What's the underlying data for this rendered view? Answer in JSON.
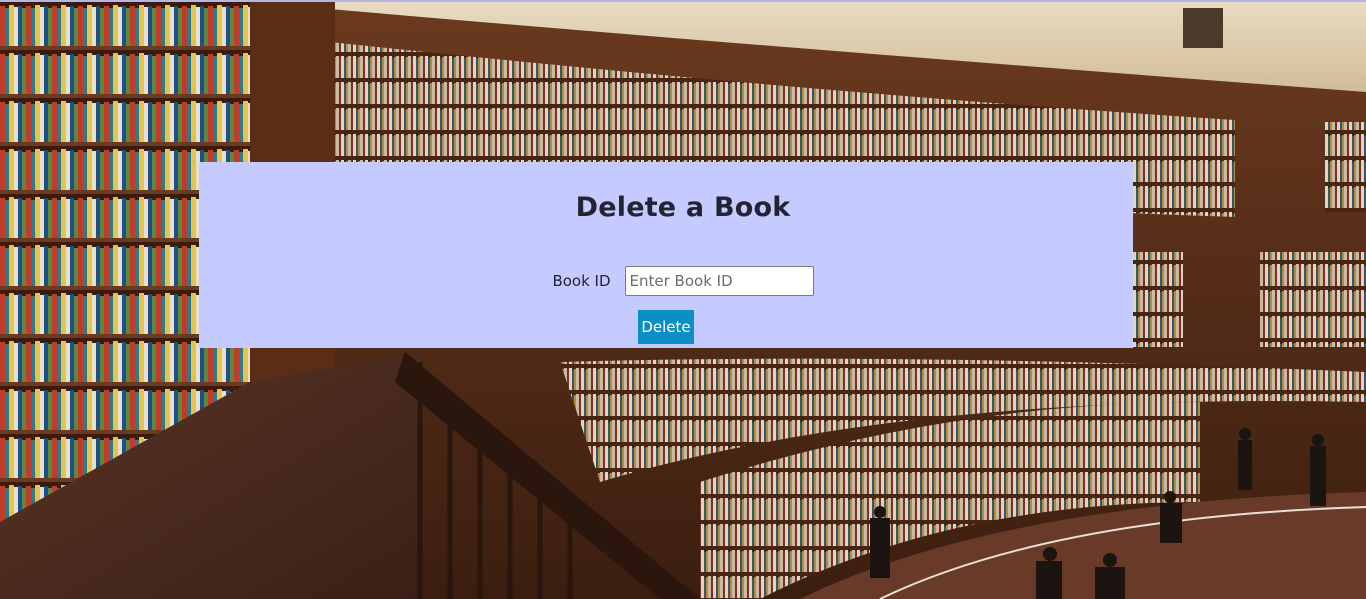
{
  "page": {
    "title": "Delete a Book",
    "background_description_icon": "library-photo"
  },
  "form": {
    "book_id_label": "Book ID",
    "book_id_placeholder": "Enter Book ID",
    "book_id_value": "",
    "submit_label": "Delete"
  },
  "colors": {
    "panel_background": "#c6cbff",
    "button_background": "#0b8fc4",
    "text": "#222433"
  }
}
